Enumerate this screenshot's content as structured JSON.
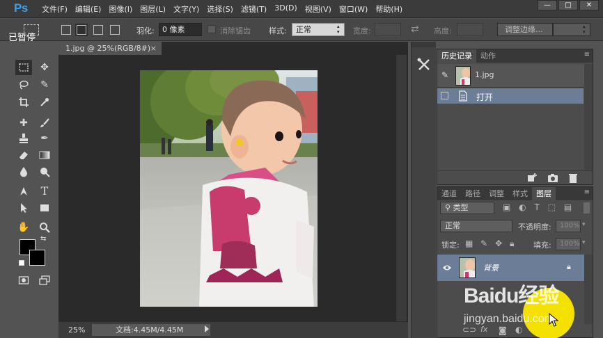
{
  "app": {
    "logo": "Ps",
    "menu": [
      "文件(F)",
      "编辑(E)",
      "图像(I)",
      "图层(L)",
      "文字(Y)",
      "选择(S)",
      "滤镜(T)",
      "3D(D)",
      "视图(V)",
      "窗口(W)",
      "帮助(H)"
    ],
    "window_controls": [
      "—",
      "□",
      "✕"
    ]
  },
  "overlay": {
    "paused": "已暂停"
  },
  "options_bar": {
    "feather_label": "羽化:",
    "feather_value": "0 像素",
    "antialias_label": "消除锯齿",
    "style_label": "样式:",
    "style_value": "正常",
    "width_label": "宽度:",
    "height_label": "高度:",
    "refine_edge": "调整边缘..."
  },
  "document": {
    "tab_title": "1.jpg @ 25%(RGB/8#)",
    "tab_close": "×",
    "zoom": "25%",
    "doc_info": "文档:4.45M/4.45M"
  },
  "history_panel": {
    "tabs": [
      "历史记录",
      "动作"
    ],
    "snapshot_name": "1.jpg",
    "steps": [
      "打开"
    ]
  },
  "layers_panel": {
    "tabs": [
      "通道",
      "路径",
      "调整",
      "样式",
      "图层"
    ],
    "filter_kind": "类型",
    "blend_mode": "正常",
    "opacity_label": "不透明度:",
    "opacity_value": "100%",
    "lock_label": "锁定:",
    "fill_label": "填充:",
    "fill_value": "100%",
    "layers": [
      {
        "name": "背景",
        "locked": true,
        "visible": true
      }
    ]
  },
  "watermark": {
    "logo": "Baidu经验",
    "url": "jingyan.baidu.com"
  },
  "colors": {
    "accent": "#3e9ee8",
    "selected_row": "#6c7d98",
    "foreground": "#000000",
    "background": "#000000",
    "watermark_circle": "#f5e100"
  }
}
